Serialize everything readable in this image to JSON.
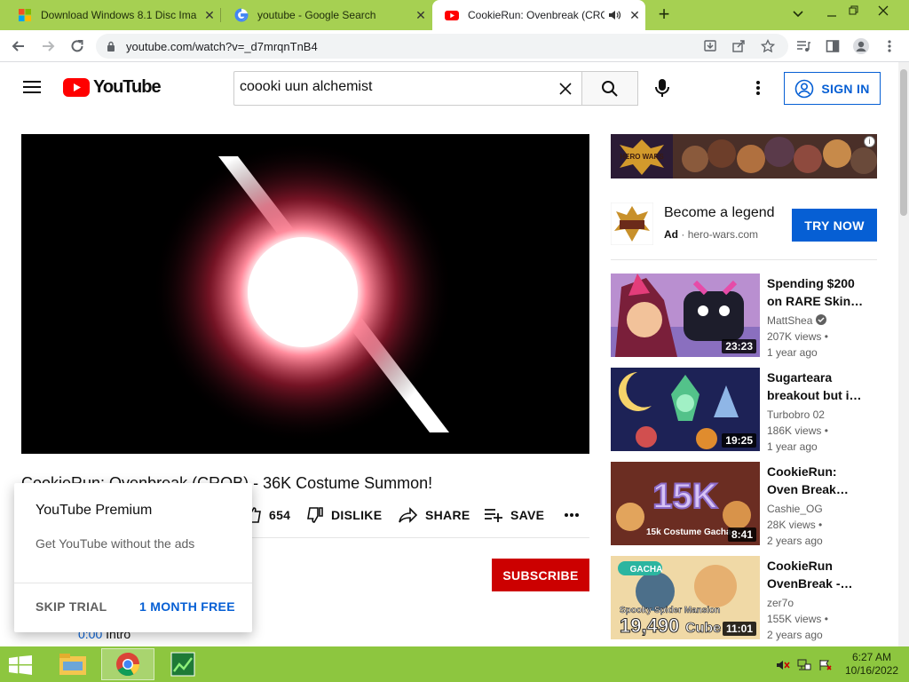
{
  "browser": {
    "tabs": [
      {
        "title": "Download Windows 8.1 Disc Ima",
        "favicon": "windows-icon",
        "active": false
      },
      {
        "title": "youtube - Google Search",
        "favicon": "google-icon",
        "active": false
      },
      {
        "title": "CookieRun: Ovenbreak (CRO",
        "favicon": "youtube-icon",
        "active": true
      }
    ],
    "new_tab_symbol": "+",
    "url": "youtube.com/watch?v=_d7mrqnTnB4"
  },
  "youtube": {
    "logo_text": "YouTube",
    "search_value": "coooki uun alchemist",
    "signin_label": "SIGN IN",
    "brand_red": "#ff0000",
    "accent_blue": "#065fd4"
  },
  "video": {
    "title": "CookieRun: Ovenbreak (CROB) - 36K Costume Summon!",
    "likes": "654",
    "dislike_label": "DISLIKE",
    "share_label": "SHARE",
    "save_label": "SAVE",
    "subscribe_label": "SUBSCRIBE",
    "chapter_time": "0:00",
    "chapter_name": "Intro"
  },
  "premium_popup": {
    "title": "YouTube Premium",
    "subtitle": "Get YouTube without the ads",
    "skip_label": "SKIP TRIAL",
    "cta_label": "1 MONTH FREE"
  },
  "ad": {
    "banner_text": "HERO WARS",
    "headline": "Become a legend",
    "badge": "Ad",
    "domain": "hero-wars.com",
    "cta": "TRY NOW"
  },
  "recommendations": [
    {
      "title1": "Spending $200",
      "title2": "on RARE Skin…",
      "channel": "MattShea",
      "verified": true,
      "views": "207K views •",
      "age": "1 year ago",
      "duration": "23:23"
    },
    {
      "title1": "Sugarteara",
      "title2": "breakout but i…",
      "channel": "Turbobro 02",
      "verified": false,
      "views": "186K views •",
      "age": "1 year ago",
      "duration": "19:25"
    },
    {
      "title1": "CookieRun:",
      "title2": "Oven Break…",
      "channel": "Cashie_OG",
      "verified": false,
      "views": "28K views •",
      "age": "2 years ago",
      "duration": "8:41",
      "thumb_big": "15K",
      "thumb_caption": "15k Costume Gacha"
    },
    {
      "title1": "CookieRun",
      "title2": "OvenBreak -…",
      "channel": "zer7o",
      "verified": false,
      "views": "155K views •",
      "age": "2 years ago",
      "duration": "11:01",
      "thumb_tag": "GACHA",
      "thumb_caption": "Spooky Spider Mansion",
      "thumb_big": "19,490",
      "thumb_unit": "Cube"
    }
  ],
  "taskbar": {
    "time": "6:27 AM",
    "date": "10/16/2022"
  }
}
